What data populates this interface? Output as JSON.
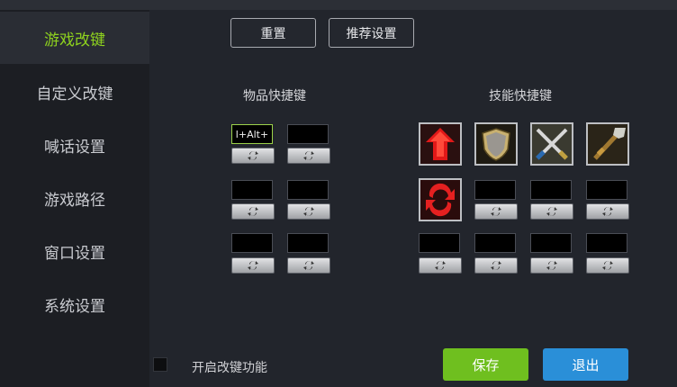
{
  "sidebar": {
    "items": [
      {
        "label": "游戏改键",
        "active": true
      },
      {
        "label": "自定义改键"
      },
      {
        "label": "喊话设置"
      },
      {
        "label": "游戏路径"
      },
      {
        "label": "窗口设置"
      },
      {
        "label": "系统设置"
      }
    ]
  },
  "toolbar": {
    "reset_label": "重置",
    "recommend_label": "推荐设置"
  },
  "items_section": {
    "title": "物品快捷键",
    "slots": [
      "l+Alt+",
      "",
      "",
      "",
      "",
      ""
    ]
  },
  "skills_section": {
    "title": "技能快捷键",
    "row1_icons": [
      "red-arrow-skill-icon",
      "shield-skill-icon",
      "crossed-swords-skill-icon",
      "spear-skill-icon"
    ],
    "row2_icons": [
      "red-swirl-skill-icon"
    ],
    "slots": [
      "",
      "",
      "",
      "",
      "",
      "",
      ""
    ]
  },
  "footer": {
    "enable_label": "开启改键功能",
    "save_label": "保存",
    "exit_label": "退出"
  },
  "colors": {
    "active_nav": "#8ed21e",
    "save_button": "#6fbf1f",
    "exit_button": "#2a8fd8",
    "sidebar_bg": "#1c1e23",
    "main_bg": "#22252c"
  }
}
